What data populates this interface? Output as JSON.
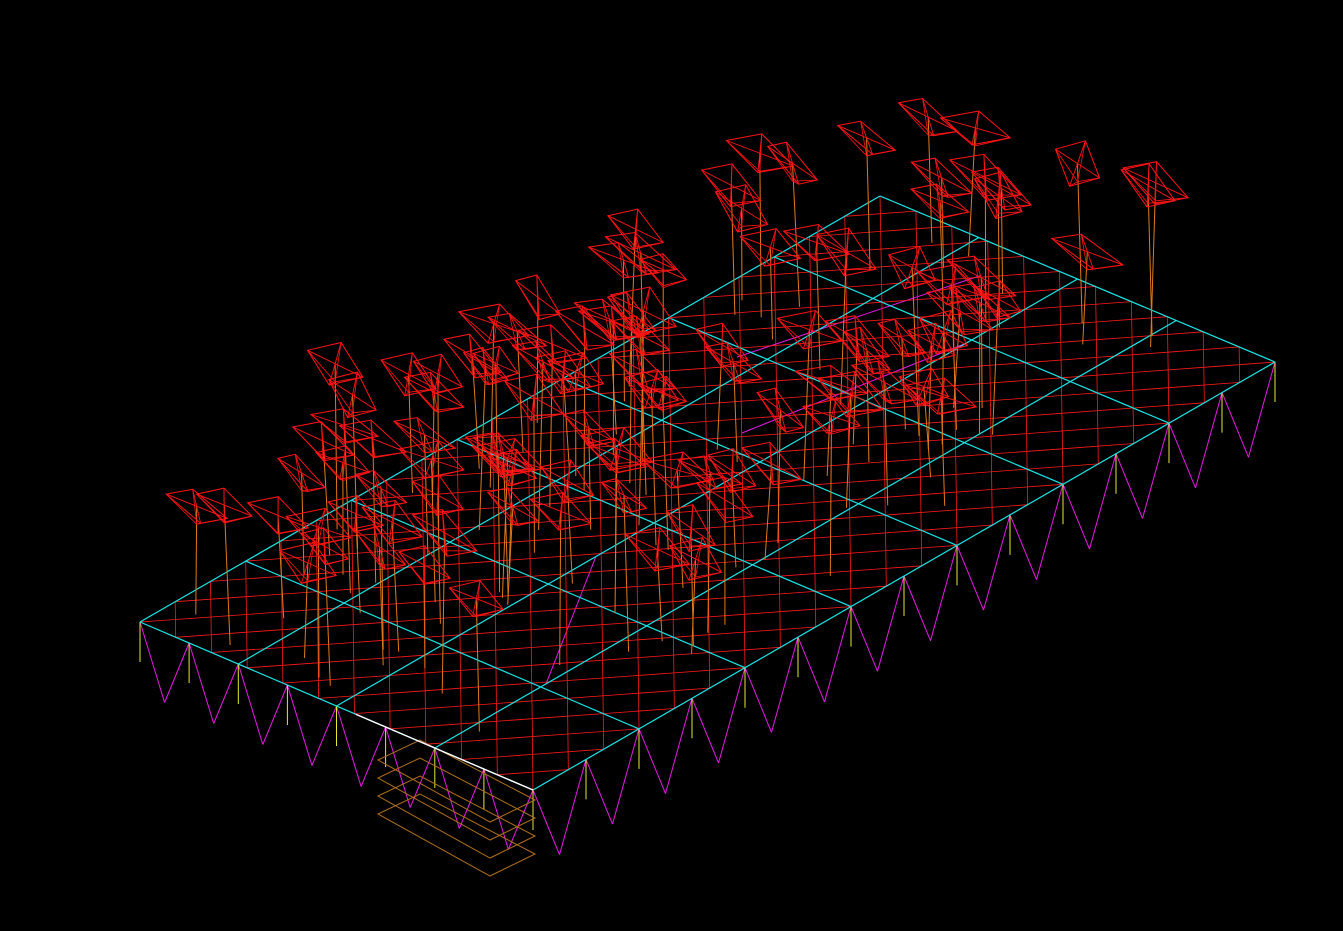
{
  "viewport": {
    "background": "#000000"
  },
  "model": {
    "grid_divisions": {
      "along": 21,
      "across": 11
    },
    "primary_bays": {
      "along": 7,
      "across": 4
    },
    "canopy_count": 110
  },
  "colors": {
    "roof_grid": "#ff1a1a",
    "primary_beams": "#19e6e6",
    "columns": "#e6e633",
    "bracing": "#e61ae6",
    "canopies": "#ff1414",
    "canopy_posts": "#e07a1a",
    "lower_frame": "#b0701a",
    "highlight_edge": "#ffffff"
  }
}
